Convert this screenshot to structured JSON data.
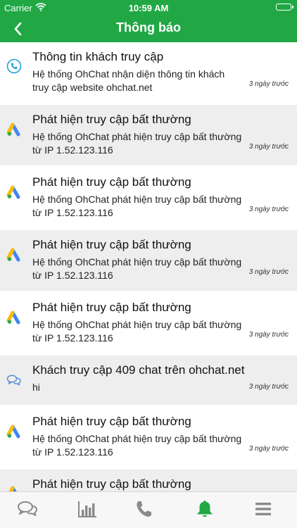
{
  "status_bar": {
    "carrier": "Carrier",
    "time": "10:59 AM"
  },
  "header": {
    "title": "Thông báo"
  },
  "notifications": [
    {
      "icon": "phone-icon",
      "title": "Thông tin khách truy cập",
      "body": "Hệ thống OhChat nhận diện thông tin khách truy cập website ohchat.net",
      "time": "3 ngày trước"
    },
    {
      "icon": "ads-icon",
      "title": "Phát hiện truy cập bất thường",
      "body": "Hệ thống OhChat phát hiện truy cập bất thường từ IP 1.52.123.116",
      "time": "3 ngày trước"
    },
    {
      "icon": "ads-icon",
      "title": "Phát hiện truy cập bất thường",
      "body": "Hệ thống OhChat phát hiện truy cập bất thường từ IP 1.52.123.116",
      "time": "3 ngày trước"
    },
    {
      "icon": "ads-icon",
      "title": "Phát hiện truy cập bất thường",
      "body": "Hệ thống OhChat phát hiện truy cập bất thường từ IP 1.52.123.116",
      "time": "3 ngày trước"
    },
    {
      "icon": "ads-icon",
      "title": "Phát hiện truy cập bất thường",
      "body": "Hệ thống OhChat phát hiện truy cập bất thường từ IP 1.52.123.116",
      "time": "3 ngày trước"
    },
    {
      "icon": "chat-icon",
      "title": "Khách truy cập 409 chat trên ohchat.net",
      "body": "hi",
      "time": "3 ngày trước"
    },
    {
      "icon": "ads-icon",
      "title": "Phát hiện truy cập bất thường",
      "body": "Hệ thống OhChat phát hiện truy cập bất thường từ IP 1.52.123.116",
      "time": "3 ngày trước"
    },
    {
      "icon": "ads-icon",
      "title": "Phát hiện truy cập bất thường",
      "body": "",
      "time": ""
    }
  ],
  "tabs": [
    {
      "icon": "chat-bubbles-icon",
      "active": false
    },
    {
      "icon": "bar-chart-icon",
      "active": false
    },
    {
      "icon": "phone-icon",
      "active": false
    },
    {
      "icon": "bell-icon",
      "active": true
    },
    {
      "icon": "menu-icon",
      "active": false
    }
  ],
  "colors": {
    "brand": "#21a845",
    "inactive_tab": "#8a8a8a",
    "phone_icon": "#1aa3d6"
  }
}
